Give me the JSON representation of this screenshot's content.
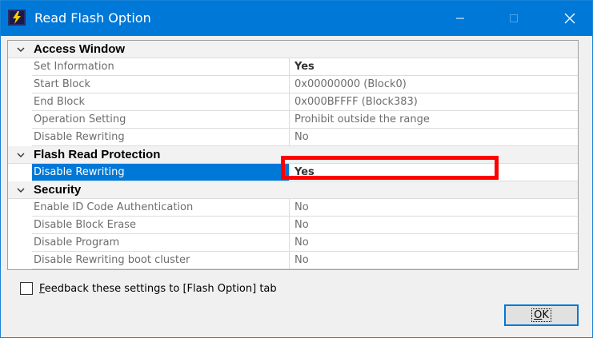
{
  "window": {
    "title": "Read Flash Option",
    "controls": {
      "minimize": "minimize-icon",
      "maximize": "maximize-icon",
      "close": "close-icon"
    }
  },
  "grid": {
    "categories": [
      {
        "label": "Access Window",
        "rows": [
          {
            "name": "Set Information",
            "value": "Yes",
            "emphasis": true
          },
          {
            "name": "Start Block",
            "value": "0x00000000 (Block0)"
          },
          {
            "name": "End Block",
            "value": "0x000BFFFF (Block383)"
          },
          {
            "name": "Operation Setting",
            "value": "Prohibit outside the range"
          },
          {
            "name": "Disable Rewriting",
            "value": "No"
          }
        ]
      },
      {
        "label": "Flash Read Protection",
        "rows": [
          {
            "name": "Disable Rewriting",
            "value": "Yes",
            "selected": true
          }
        ]
      },
      {
        "label": "Security",
        "rows": [
          {
            "name": "Enable ID Code Authentication",
            "value": "No"
          },
          {
            "name": "Disable Block Erase",
            "value": "No"
          },
          {
            "name": "Disable Program",
            "value": "No"
          },
          {
            "name": "Disable Rewriting boot cluster",
            "value": "No"
          }
        ]
      }
    ]
  },
  "footer": {
    "checkbox_mnemonic": "F",
    "checkbox_label_rest": "eedback these settings to [Flash Option] tab",
    "checkbox_checked": false,
    "ok_mnemonic": "O",
    "ok_rest": "K"
  },
  "colors": {
    "titlebar": "#0078d7",
    "selection": "#0078d7",
    "highlight": "#ff0000"
  }
}
